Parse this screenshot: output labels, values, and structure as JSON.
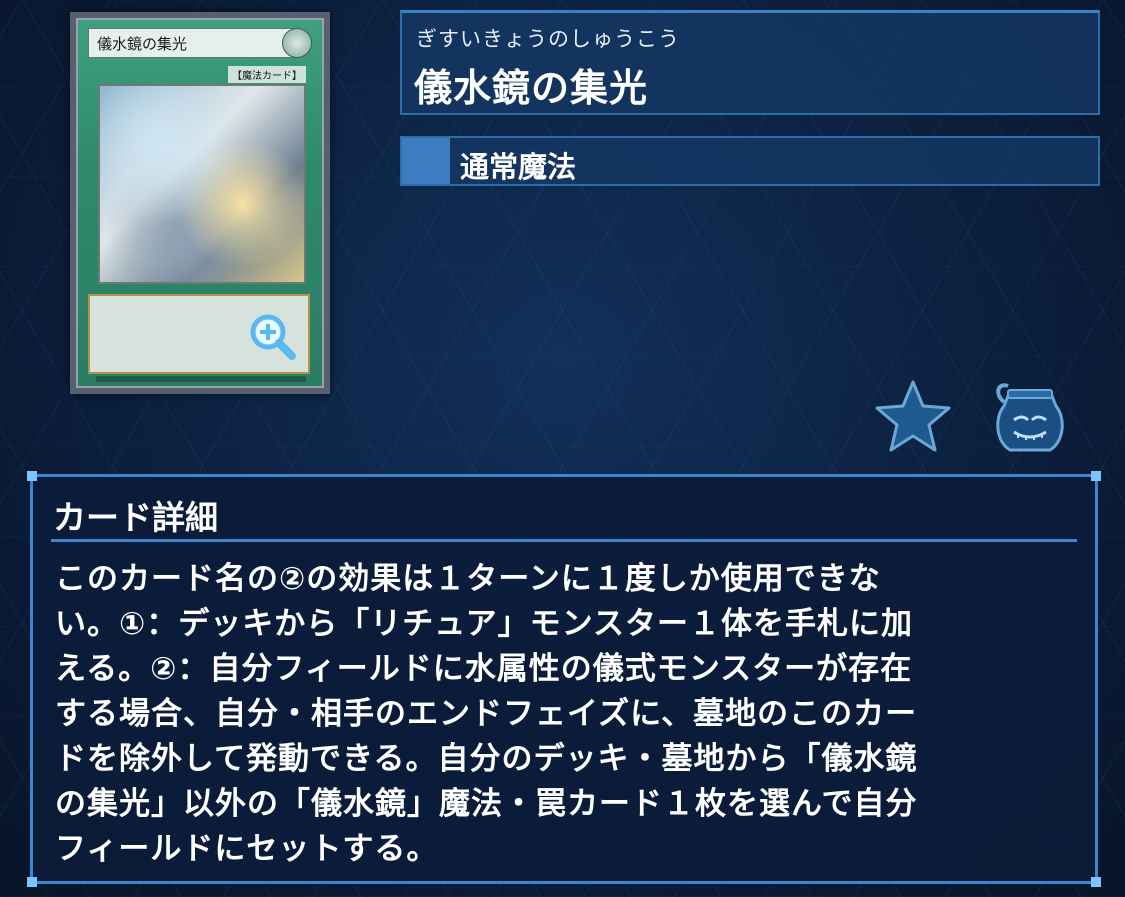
{
  "card": {
    "name_on_card": "儀水鏡の集光",
    "type_label_on_card": "【魔法カード】",
    "zoom_icon": "zoom-in-icon"
  },
  "header": {
    "reading": "ぎすいきょうのしゅうこう",
    "title": "儀水鏡の集光",
    "card_type": "通常魔法"
  },
  "actions": {
    "favorite_icon": "star-icon",
    "pot_icon": "pot-of-greed-icon"
  },
  "detail": {
    "heading": "カード詳細",
    "text": "このカード名の②の効果は１ターンに１度しか使用できな\nい。①：デッキから「リチュア」モンスター１体を手札に加\nえる。②：自分フィールドに水属性の儀式モンスターが存在\nする場合、自分・相手のエンドフェイズに、墓地のこのカー\nドを除外して発動できる。自分のデッキ・墓地から「儀水鏡\nの集光」以外の「儀水鏡」魔法・罠カード１枚を選んで自分\nフィールドにセットする。"
  },
  "colors": {
    "accent": "#3b86cf",
    "panel": "#143764",
    "card_frame": "#2f8a6b"
  }
}
